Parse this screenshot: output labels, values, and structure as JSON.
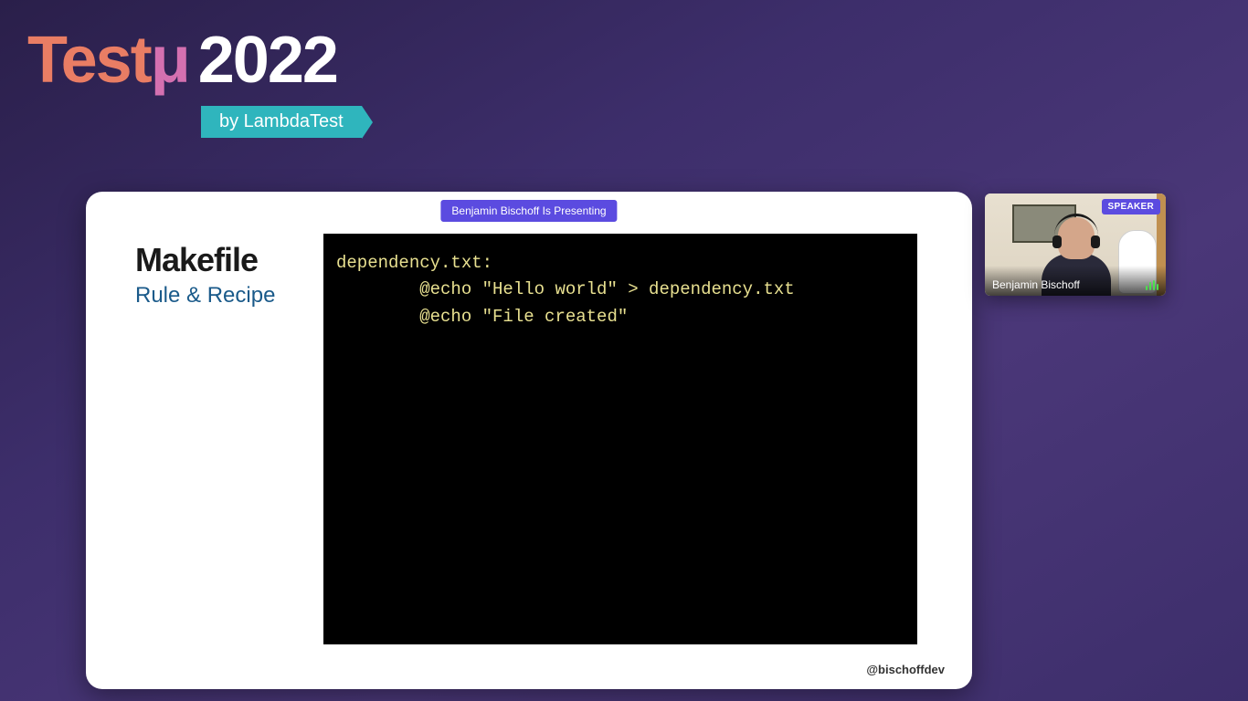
{
  "brand": {
    "word_test": "Test",
    "word_mu": "μ",
    "year": "2022",
    "byline": "by LambdaTest"
  },
  "presenting_pill": "Benjamin Bischoff Is Presenting",
  "slide": {
    "heading": "Makefile",
    "subheading": "Rule & Recipe",
    "code": "dependency.txt:\n        @echo \"Hello world\" > dependency.txt\n        @echo \"File created\"",
    "footer_handle": "@bischoffdev"
  },
  "webcam": {
    "badge": "SPEAKER",
    "name": "Benjamin Bischoff"
  }
}
